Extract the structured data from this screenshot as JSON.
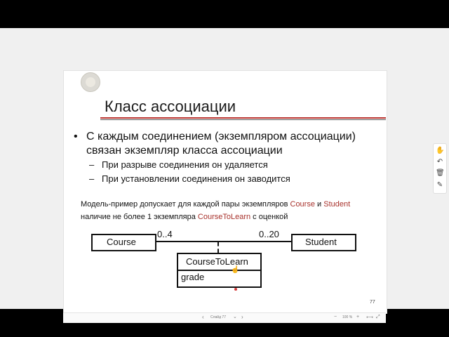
{
  "slide": {
    "title": "Класс ассоциации",
    "bullet": {
      "marker": "•",
      "text": "С каждым соединением (экземпляром ассоциации) связан экземпляр класса ассоциации"
    },
    "sub_bullets": [
      {
        "marker": "–",
        "text": "При разрыве соединения он удаляется"
      },
      {
        "marker": "–",
        "text": "При установлении соединения он заводится"
      }
    ],
    "note": {
      "part1": "Модель-пример допускает для каждой пары экземпляров ",
      "course": "Course",
      "and": " и ",
      "student": "Student",
      "part2": "наличие не более 1 экземпляра ",
      "coursetolearn": "CourseToLearn",
      "part3": " с оценкой"
    },
    "diagram": {
      "class_left": "Course",
      "class_right": "Student",
      "mult_left": "0..4",
      "mult_right": "0..20",
      "assoc_class": "CourseToLearn",
      "attribute": "grade"
    },
    "page_number": "77"
  },
  "statusbar": {
    "prev": "‹",
    "slide_label": "Слайд 77",
    "chevron": "⌄",
    "next": "›",
    "zoom_out": "−",
    "zoom_level": "100 %",
    "zoom_in": "+",
    "fit": "⟷",
    "fullscreen": "⤢"
  },
  "sidebar": {
    "icons": [
      "hand-icon",
      "undo-icon",
      "trash-icon",
      "note-icon"
    ]
  },
  "colors": {
    "accent_red": "#b8322e",
    "highlight_text": "#a8322c"
  }
}
